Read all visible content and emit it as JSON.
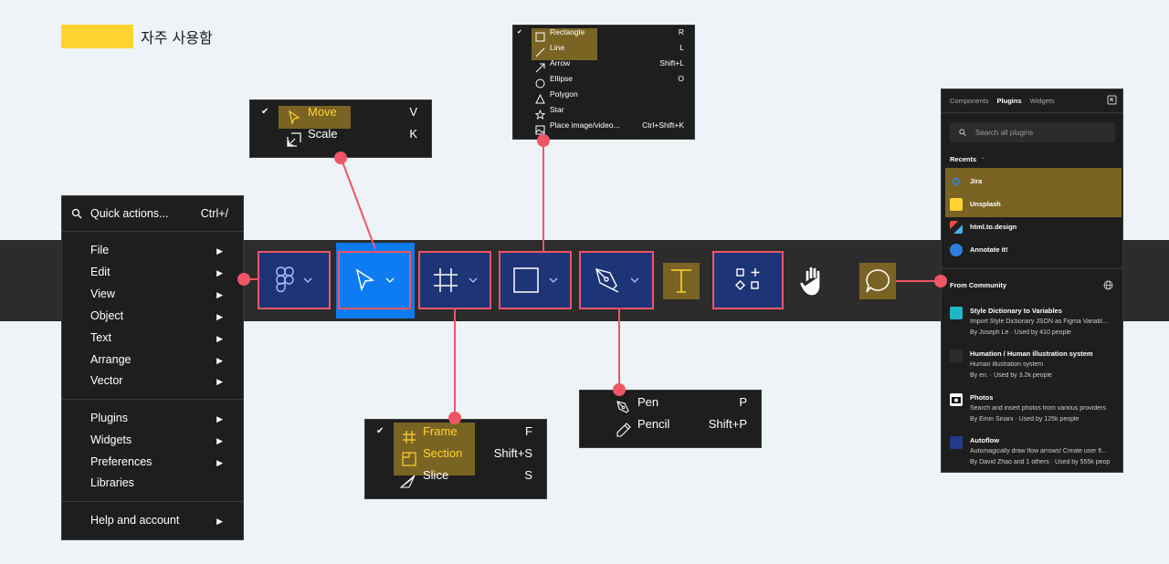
{
  "legend": {
    "label": "자주 사용함",
    "color": "#ffd330"
  },
  "main_menu": {
    "search_label": "Quick actions...",
    "search_shortcut": "Ctrl+/",
    "items": [
      "File",
      "Edit",
      "View",
      "Object",
      "Text",
      "Arrange",
      "Vector",
      "Plugins",
      "Widgets",
      "Preferences",
      "Libraries",
      "Help and account"
    ]
  },
  "move_menu": {
    "items": [
      {
        "label": "Move",
        "shortcut": "V"
      },
      {
        "label": "Scale",
        "shortcut": "K"
      }
    ]
  },
  "frame_menu": {
    "items": [
      {
        "label": "Frame",
        "shortcut": "F"
      },
      {
        "label": "Section",
        "shortcut": "Shift+S"
      },
      {
        "label": "Slice",
        "shortcut": "S"
      }
    ]
  },
  "shape_menu": {
    "items": [
      {
        "label": "Rectangle",
        "shortcut": "R"
      },
      {
        "label": "Line",
        "shortcut": "L"
      },
      {
        "label": "Arrow",
        "shortcut": "Shift+L"
      },
      {
        "label": "Ellipse",
        "shortcut": "O"
      },
      {
        "label": "Polygon",
        "shortcut": ""
      },
      {
        "label": "Star",
        "shortcut": ""
      },
      {
        "label": "Place image/video...",
        "shortcut": "Ctrl+Shift+K"
      }
    ]
  },
  "pen_menu": {
    "items": [
      {
        "label": "Pen",
        "shortcut": "P"
      },
      {
        "label": "Pencil",
        "shortcut": "Shift+P"
      }
    ]
  },
  "plugins_panel": {
    "tabs": [
      "Components",
      "Plugins",
      "Widgets"
    ],
    "search_placeholder": "Search all plugins",
    "recents_label": "Recents",
    "recents": [
      "Jira",
      "Unsplash",
      "html.to.design",
      "Annotate it!"
    ],
    "community_label": "From Community",
    "community": [
      {
        "title": "Style Dictionary to Variables",
        "desc": "Import Style Dictionary JSON as Figma Variabl...",
        "meta": "By Joseph Le · Used by 410 people"
      },
      {
        "title": "Humation / Human illustration system",
        "desc": "Human illustration system",
        "meta": "By en. · Used by 3.2k people"
      },
      {
        "title": "Photos",
        "desc": "Search and insert photos from various providers",
        "meta": "By Emin Sinani · Used by 125k people"
      },
      {
        "title": "Autoflow",
        "desc": "Automagically draw flow arrows! Create user fl...",
        "meta": "By David Zhao and 1 others · Used by 555k peop"
      }
    ]
  },
  "colors": {
    "annotation": "#ef5566",
    "frequent_highlight": "#7a6424",
    "tool_box": "#1d3577",
    "active_tool": "#0d7cf2",
    "toolbar_bg": "#2c2c2c"
  }
}
